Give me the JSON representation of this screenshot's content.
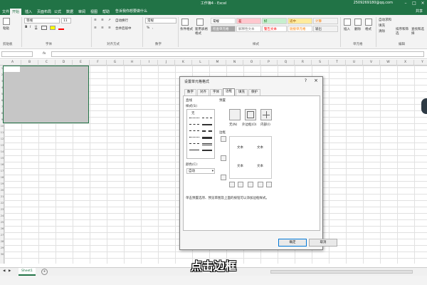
{
  "window": {
    "title": "工作簿4 - Excel",
    "account": "2509269180@qq.com"
  },
  "tabs": [
    "文件",
    "开始",
    "插入",
    "页面布局",
    "公式",
    "数据",
    "审阅",
    "视图",
    "帮助"
  ],
  "active_tab_index": 1,
  "tellme": "告诉我你想要做什么",
  "share": "共享",
  "ribbon": {
    "clipboard": {
      "label": "剪贴板",
      "paste": "粘贴"
    },
    "font": {
      "label": "字体",
      "name": "等线",
      "size": "11",
      "bold": "B",
      "italic": "I",
      "underline": "U"
    },
    "alignment": {
      "label": "对齐方式",
      "wrap": "自动换行",
      "merge": "合并后居中"
    },
    "number": {
      "label": "数字",
      "format": "常规",
      "percent": "%",
      "comma": ","
    },
    "styles": {
      "label": "样式",
      "cond": "条件格式",
      "table": "套用表格格式",
      "cells": [
        {
          "text": "常规",
          "bg": "#ffffff",
          "fg": "#000000"
        },
        {
          "text": "差",
          "bg": "#ffc7ce",
          "fg": "#9c0006"
        },
        {
          "text": "好",
          "bg": "#c6efce",
          "fg": "#006100"
        },
        {
          "text": "适中",
          "bg": "#ffeb9c",
          "fg": "#9c5700"
        },
        {
          "text": "计算",
          "bg": "#f2f2f2",
          "fg": "#fa7d00"
        },
        {
          "text": "检查单元格",
          "bg": "#a5a5a5",
          "fg": "#ffffff"
        },
        {
          "text": "解释性文本",
          "bg": "#ffffff",
          "fg": "#7f7f7f"
        },
        {
          "text": "警告文本",
          "bg": "#ffffff",
          "fg": "#ff0000"
        },
        {
          "text": "链接单元格",
          "bg": "#ffffff",
          "fg": "#fa7d00"
        },
        {
          "text": "输出",
          "bg": "#f2f2f2",
          "fg": "#3f3f3f"
        }
      ]
    },
    "cells": {
      "label": "单元格",
      "insert": "插入",
      "delete": "删除",
      "format": "格式"
    },
    "editing": {
      "label": "编辑",
      "autosum": "自动求和",
      "fill": "填充",
      "clear": "清除",
      "sort": "排序和筛选",
      "find": "查找和选择"
    }
  },
  "formula_bar": {
    "namebox": "",
    "fx": "fx"
  },
  "columns": [
    "A",
    "B",
    "C",
    "D",
    "E",
    "F",
    "G",
    "H",
    "I",
    "J",
    "K",
    "L",
    "M",
    "N",
    "O",
    "P",
    "Q",
    "R",
    "S",
    "T",
    "U",
    "V",
    "W",
    "X",
    "Y"
  ],
  "rows": [
    "1",
    "2",
    "3",
    "4",
    "5",
    "6",
    "7",
    "8",
    "9",
    "10",
    "11",
    "12",
    "13",
    "14",
    "15",
    "16",
    "17",
    "18",
    "19",
    "20",
    "21",
    "22",
    "23",
    "24",
    "25",
    "26",
    "27",
    "28",
    "29",
    "30"
  ],
  "sheet": {
    "name": "Sheet1",
    "add": "+"
  },
  "dialog": {
    "title": "设置单元格格式",
    "help": "?",
    "close": "×",
    "tabs": [
      "数字",
      "对齐",
      "字体",
      "边框",
      "填充",
      "保护"
    ],
    "active_tab_index": 3,
    "line_group": "直线",
    "style_label": "样式(S):",
    "none_style": "无",
    "color_label": "颜色(C):",
    "color_value": "自动",
    "presets_label": "预置",
    "presets": [
      "无(N)",
      "外边框(O)",
      "内部(I)"
    ],
    "border_label": "边框",
    "preview_text": [
      "文本",
      "文本",
      "文本",
      "文本"
    ],
    "hint": "单击预置选项、预览草图及上面的按钮可以添加边框样式。",
    "ok": "确定",
    "cancel": "取消"
  },
  "caption": "点击边框"
}
